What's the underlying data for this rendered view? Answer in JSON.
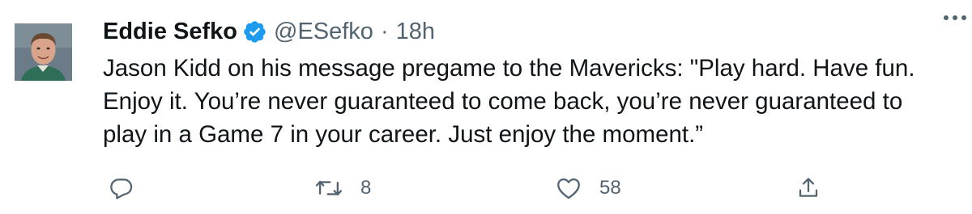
{
  "tweet": {
    "author": {
      "display_name": "Eddie Sefko",
      "handle": "@ESefko",
      "verified": true
    },
    "separator": "·",
    "timestamp": "18h",
    "text": "Jason Kidd on his message pregame to the Mavericks: \"Play hard. Have fun.\nEnjoy it. You’re never guaranteed to come back, you’re never guaranteed to\nplay in a Game 7 in your career. Just enjoy the moment.”",
    "actions": {
      "reply": {
        "icon": "reply-icon"
      },
      "retweet": {
        "icon": "retweet-icon",
        "count": "8"
      },
      "like": {
        "icon": "heart-icon",
        "count": "58"
      },
      "share": {
        "icon": "share-icon"
      }
    }
  },
  "colors": {
    "text_primary": "#0f1419",
    "text_secondary": "#536471",
    "verified_blue": "#1d9bf0"
  }
}
